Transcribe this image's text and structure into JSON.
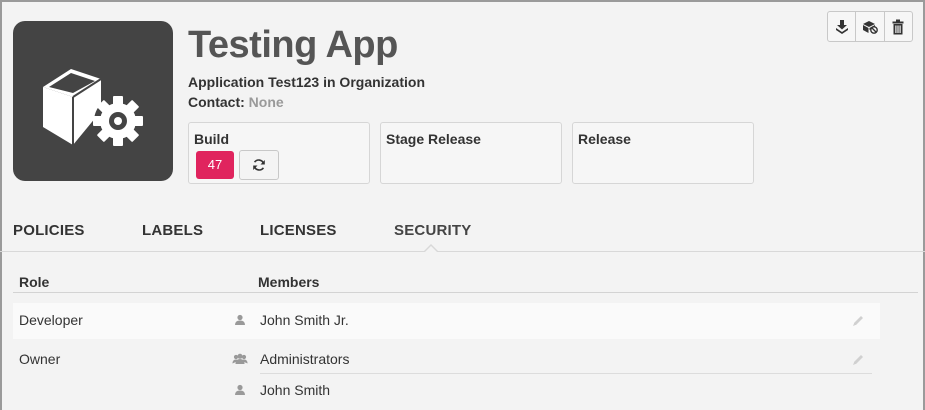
{
  "header": {
    "title": "Testing App",
    "subtitle": "Application Test123 in Organization",
    "contact_label": "Contact:",
    "contact_value": "None"
  },
  "stages": {
    "build": {
      "label": "Build",
      "number": "47"
    },
    "stage_release": {
      "label": "Stage Release"
    },
    "release": {
      "label": "Release"
    }
  },
  "toolbar": {
    "icons": [
      "download-icon",
      "unlink-icon",
      "trash-icon"
    ]
  },
  "tabs": [
    {
      "label": "POLICIES",
      "active": false
    },
    {
      "label": "LABELS",
      "active": false
    },
    {
      "label": "LICENSES",
      "active": false
    },
    {
      "label": "SECURITY",
      "active": true
    }
  ],
  "table": {
    "headers": {
      "role": "Role",
      "members": "Members"
    },
    "rows": [
      {
        "role": "Developer",
        "members": [
          {
            "name": "John Smith Jr.",
            "type": "user"
          }
        ]
      },
      {
        "role": "Owner",
        "members": [
          {
            "name": "Administrators",
            "type": "group"
          },
          {
            "name": "John Smith",
            "type": "user"
          }
        ]
      }
    ]
  },
  "colors": {
    "accent": "#e0245e",
    "icon_bg": "#444444",
    "background": "#f3f3f3"
  }
}
